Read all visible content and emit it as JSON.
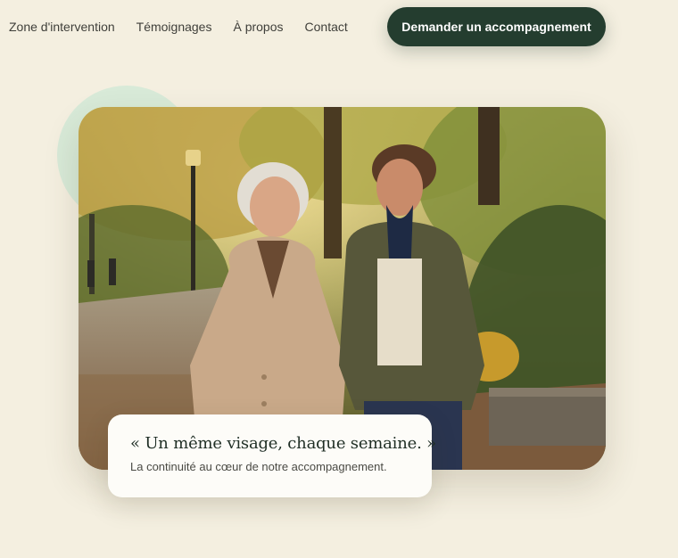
{
  "nav": {
    "links": [
      {
        "label": "Zone d'intervention"
      },
      {
        "label": "Témoignages"
      },
      {
        "label": "À propos"
      },
      {
        "label": "Contact"
      }
    ],
    "cta_label": "Demander un accompagnement"
  },
  "hero": {
    "image_description_icon": "photo-two-women-walking-autumn-park",
    "quote": {
      "title": "« Un même visage, chaque semaine. »",
      "subtitle": "La continuité au cœur de notre accompagnement."
    }
  },
  "colors": {
    "background": "#f4efe0",
    "accent_dark_green": "#243d2f",
    "decor_mint": "#d8ead8",
    "card": "#fdfcf8"
  }
}
